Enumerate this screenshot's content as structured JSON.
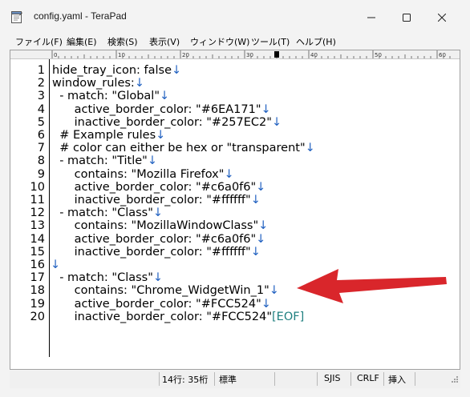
{
  "window": {
    "title": "config.yaml - TeraPad",
    "minimize_glyph": "—",
    "close_glyph": "✕"
  },
  "menu": [
    {
      "label": "ファイル(F)"
    },
    {
      "label": "編集(E)"
    },
    {
      "label": "検索(S)"
    },
    {
      "label": "表示(V)"
    },
    {
      "label": "ウィンドウ(W)"
    },
    {
      "label": "ツール(T)"
    },
    {
      "label": "ヘルプ(H)"
    }
  ],
  "ruler": {
    "labels": [
      "0",
      "10",
      "20",
      "30",
      "40",
      "50",
      "60"
    ]
  },
  "editor": {
    "eol_marker": "↓",
    "eof_marker": "[EOF]",
    "lines": [
      {
        "no": "1",
        "text": "hide_tray_icon: false",
        "eol": true
      },
      {
        "no": "2",
        "text": "window_rules:",
        "eol": true
      },
      {
        "no": "3",
        "text": "  - match: \"Global\"",
        "eol": true
      },
      {
        "no": "4",
        "text": "      active_border_color: \"#6EA171\"",
        "eol": true
      },
      {
        "no": "5",
        "text": "      inactive_border_color: \"#257EC2\"",
        "eol": true
      },
      {
        "no": "6",
        "text": "  # Example rules",
        "eol": true
      },
      {
        "no": "7",
        "text": "  # color can either be hex or \"transparent\"",
        "eol": true
      },
      {
        "no": "8",
        "text": "  - match: \"Title\"",
        "eol": true
      },
      {
        "no": "9",
        "text": "      contains: \"Mozilla Firefox\"",
        "eol": true
      },
      {
        "no": "10",
        "text": "      active_border_color: \"#c6a0f6\"",
        "eol": true
      },
      {
        "no": "11",
        "text": "      inactive_border_color: \"#ffffff\"",
        "eol": true
      },
      {
        "no": "12",
        "text": "  - match: \"Class\"",
        "eol": true
      },
      {
        "no": "13",
        "text": "      contains: \"MozillaWindowClass\"",
        "eol": true
      },
      {
        "no": "14",
        "text": "      active_border_color: \"#c6a0f6\"",
        "eol": true
      },
      {
        "no": "15",
        "text": "      inactive_border_color: \"#ffffff\"",
        "eol": true
      },
      {
        "no": "16",
        "text": "",
        "eol": true
      },
      {
        "no": "17",
        "text": "  - match: \"Class\"",
        "eol": true
      },
      {
        "no": "18",
        "text": "      contains: \"Chrome_WidgetWin_1\"",
        "eol": true
      },
      {
        "no": "19",
        "text": "      active_border_color: \"#FCC524\"",
        "eol": true
      },
      {
        "no": "20",
        "text": "      inactive_border_color: \"#FCC524\"",
        "eol": false,
        "eof": true
      }
    ]
  },
  "status": {
    "position": "14行:  35桁",
    "mode": "標準",
    "encoding": "SJIS",
    "line_ending": "CRLF",
    "insert": "挿入"
  },
  "colors": {
    "eol": "#2060c0",
    "eof": "#208080",
    "arrow": "#d9262b"
  }
}
